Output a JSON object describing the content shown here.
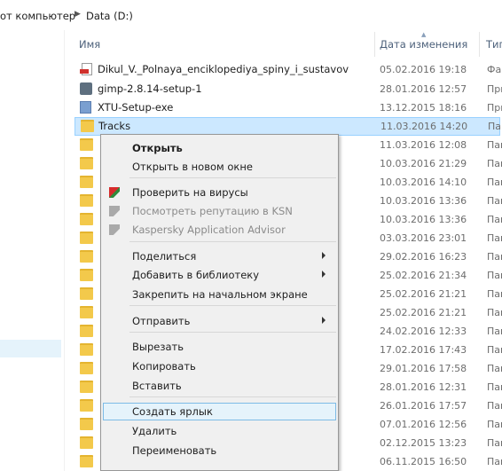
{
  "breadcrumb": {
    "part1": "от компьютер",
    "part2": "Data (D:)"
  },
  "columns": {
    "name": "Имя",
    "date": "Дата изменения",
    "type": "Тип"
  },
  "files": [
    {
      "name": "Dikul_V._Polnaya_enciklopediya_spiny_i_sustavov",
      "date": "05.02.2016 19:18",
      "type": "Фай",
      "icon": "pdf-icon"
    },
    {
      "name": "gimp-2.8.14-setup-1",
      "date": "28.01.2016 12:57",
      "type": "При",
      "icon": "gimp-installer-icon"
    },
    {
      "name": "XTU-Setup-exe",
      "date": "13.12.2015 18:16",
      "type": "При",
      "icon": "installer-icon"
    },
    {
      "name": "Tracks",
      "date": "11.03.2016 14:20",
      "type": "Пап",
      "icon": "folder-icon",
      "selected": true
    },
    {
      "name": "",
      "date": "11.03.2016 12:08",
      "type": "Пап",
      "icon": "folder-icon"
    },
    {
      "name": "",
      "date": "10.03.2016 21:29",
      "type": "Пап",
      "icon": "folder-icon"
    },
    {
      "name": "",
      "date": "10.03.2016 14:10",
      "type": "Пап",
      "icon": "folder-icon"
    },
    {
      "name": "",
      "date": "10.03.2016 13:36",
      "type": "Пап",
      "icon": "folder-icon"
    },
    {
      "name": "",
      "date": "10.03.2016 13:36",
      "type": "Пап",
      "icon": "folder-icon"
    },
    {
      "name": "",
      "date": "03.03.2016 23:01",
      "type": "Пап",
      "icon": "folder-icon"
    },
    {
      "name": "",
      "date": "29.02.2016 16:23",
      "type": "Пап",
      "icon": "folder-icon"
    },
    {
      "name": "",
      "date": "25.02.2016 21:34",
      "type": "Пап",
      "icon": "folder-icon"
    },
    {
      "name": "",
      "date": "25.02.2016 21:21",
      "type": "Пап",
      "icon": "folder-icon"
    },
    {
      "name": "",
      "date": "25.02.2016 21:21",
      "type": "Пап",
      "icon": "folder-icon"
    },
    {
      "name": "",
      "date": "24.02.2016 12:33",
      "type": "Пап",
      "icon": "folder-icon"
    },
    {
      "name": "",
      "date": "17.02.2016 17:43",
      "type": "Пап",
      "icon": "folder-icon"
    },
    {
      "name": "",
      "date": "29.01.2016 17:58",
      "type": "Пап",
      "icon": "folder-icon"
    },
    {
      "name": "",
      "date": "28.01.2016 12:31",
      "type": "Пап",
      "icon": "folder-icon"
    },
    {
      "name": "",
      "date": "26.01.2016 17:57",
      "type": "Пап",
      "icon": "folder-icon"
    },
    {
      "name": "",
      "date": "07.01.2016 12:56",
      "type": "Пап",
      "icon": "folder-icon"
    },
    {
      "name": "",
      "date": "02.12.2015 13:23",
      "type": "Пап",
      "icon": "folder-icon"
    },
    {
      "name": "",
      "date": "06.11.2015 16:50",
      "type": "Пап",
      "icon": "folder-icon"
    }
  ],
  "context_menu": {
    "items": [
      {
        "label": "Открыть",
        "bold": true
      },
      {
        "label": "Открыть в новом окне"
      },
      {
        "label": "Проверить на вирусы",
        "icon": "kaspersky-icon"
      },
      {
        "label": "Посмотреть репутацию в KSN",
        "icon": "kaspersky-icon",
        "disabled": true
      },
      {
        "label": "Kaspersky Application Advisor",
        "icon": "kaspersky-icon",
        "disabled": true
      },
      {
        "label": "Поделиться",
        "submenu": true
      },
      {
        "label": "Добавить в библиотеку",
        "submenu": true
      },
      {
        "label": "Закрепить на начальном экране"
      },
      {
        "label": "Отправить",
        "submenu": true
      },
      {
        "label": "Вырезать"
      },
      {
        "label": "Копировать"
      },
      {
        "label": "Вставить"
      },
      {
        "label": "Создать ярлык",
        "highlighted": true
      },
      {
        "label": "Удалить"
      },
      {
        "label": "Переименовать"
      }
    ]
  }
}
